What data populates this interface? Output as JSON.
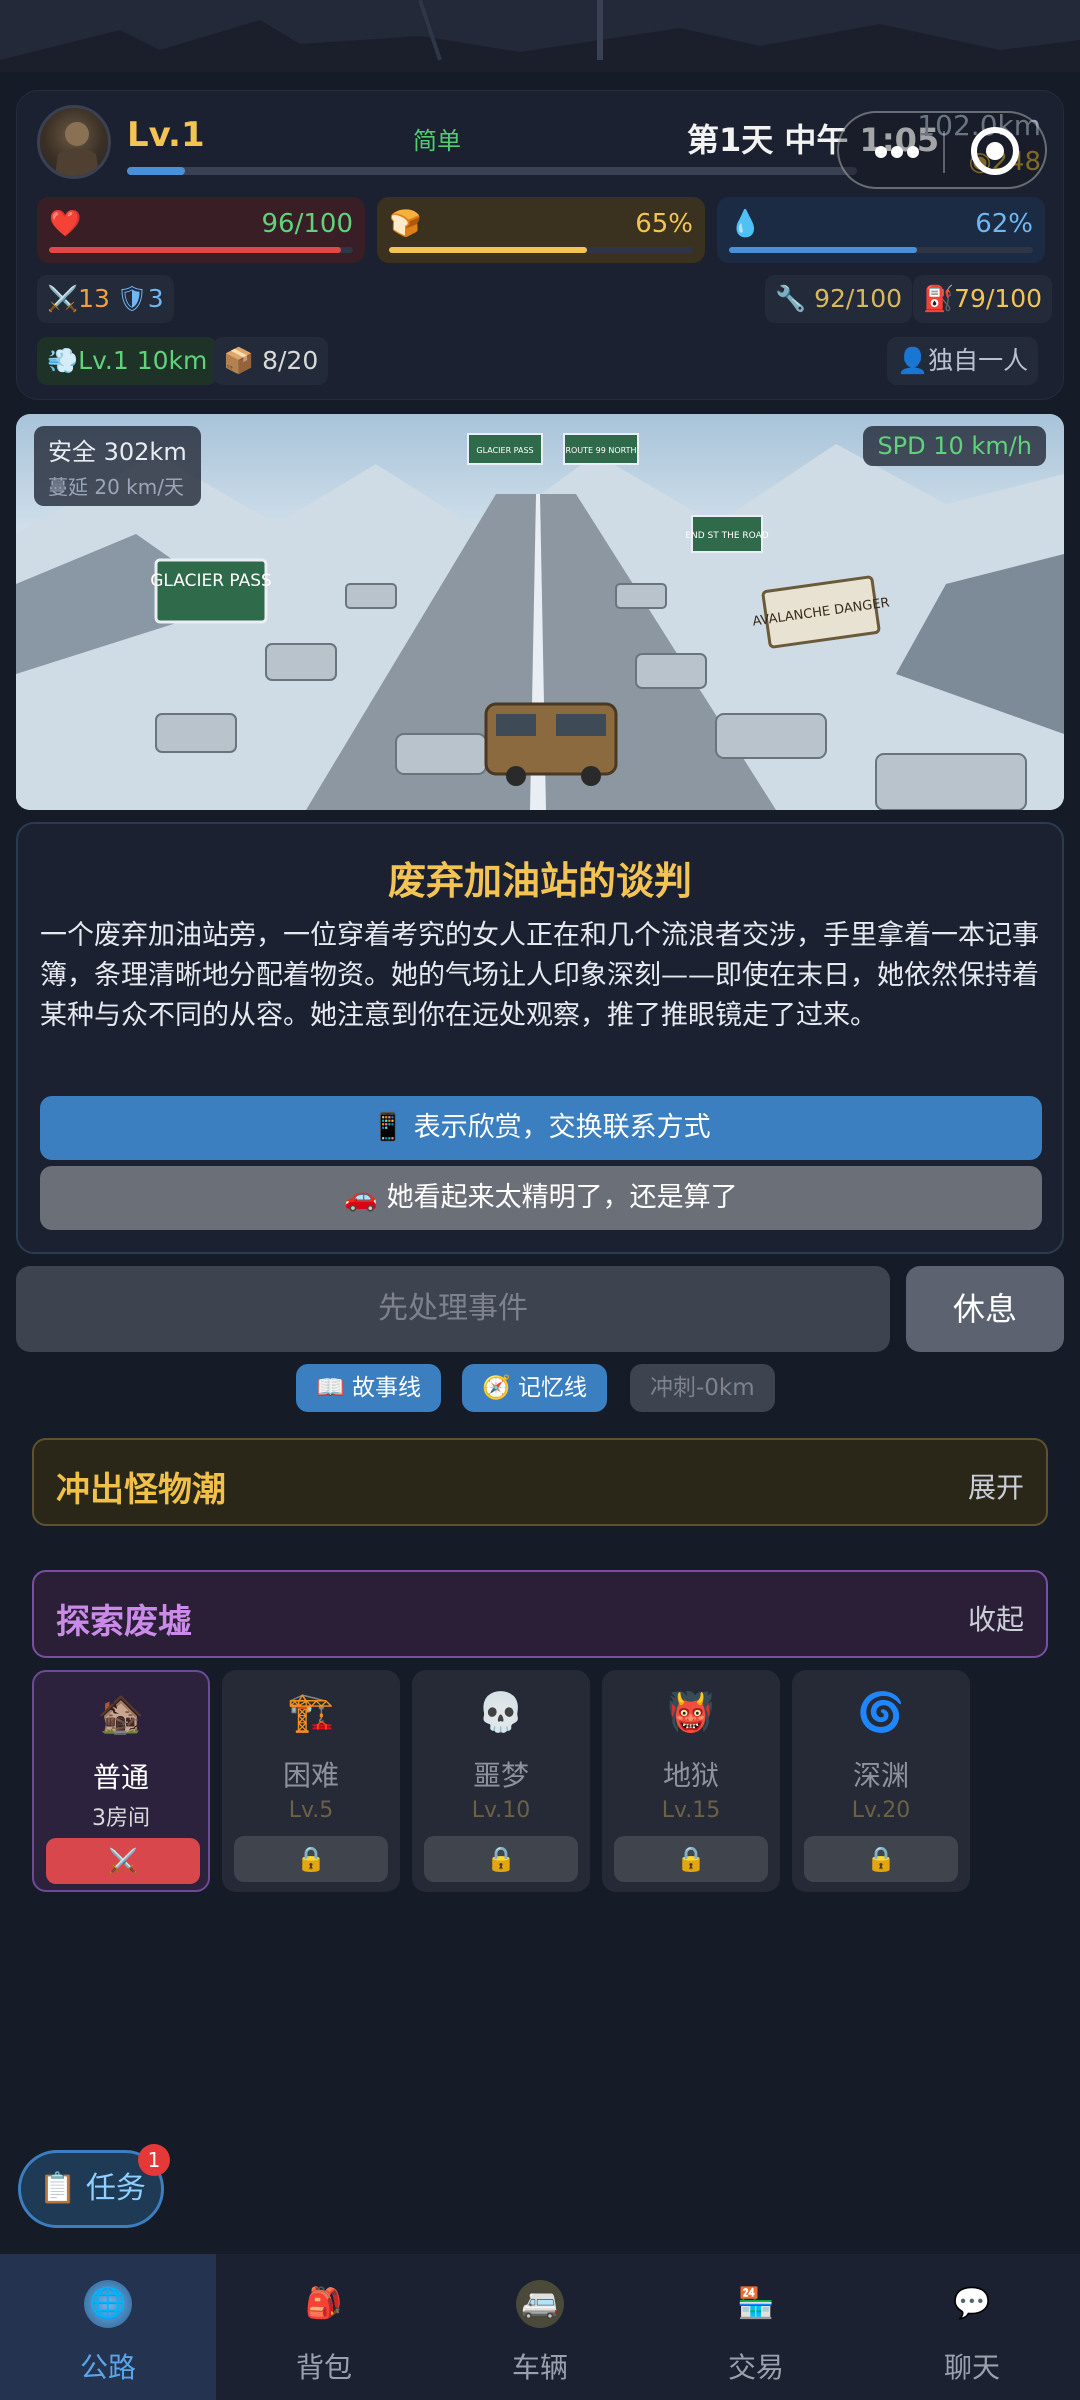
{
  "status": {
    "level": "Lv.1",
    "difficulty": "简单",
    "day_time": "第1天 中午 1:05",
    "distance": "102.0km",
    "coins": "248",
    "xp_fraction": 0.08,
    "hp": {
      "icon": "heart-icon",
      "value": "96/100",
      "fraction": 0.96,
      "color": "#e24646"
    },
    "food": {
      "icon": "bread-icon",
      "value": "65%",
      "fraction": 0.65,
      "color": "#f3c454"
    },
    "water": {
      "icon": "water-drop-icon",
      "value": "62%",
      "fraction": 0.62,
      "color": "#4a90d9"
    },
    "attack": "13",
    "defense": "3",
    "repair": "92/100",
    "fuel": "79/100",
    "speed": "Lv.1 10km",
    "cargo": "8/20",
    "team": "独自一人"
  },
  "scene": {
    "safe_distance": "安全 302km",
    "spread": "蔓延 20 km/天",
    "speed": "SPD 10 km/h",
    "signs": [
      "GLACIER PASS",
      "AVALANCHE DANGER",
      "END ST THE ROAD",
      "GLACIER PASS",
      "ROUTE 99 NORTH"
    ]
  },
  "event": {
    "title": "废弃加油站的谈判",
    "description": "一个废弃加油站旁，一位穿着考究的女人正在和几个流浪者交涉，手里拿着一本记事簿，条理清晰地分配着物资。她的气场让人印象深刻——即使在末日，她依然保持着某种与众不同的从容。她注意到你在远处观察，推了推眼镜走了过来。",
    "choices": [
      {
        "icon": "📱",
        "label": "表示欣赏，交换联系方式"
      },
      {
        "icon": "🚗",
        "label": "她看起来太精明了，还是算了"
      }
    ]
  },
  "actions": {
    "primary": "先处理事件",
    "rest": "休息"
  },
  "pills": {
    "story": "📖 故事线",
    "memory": "🧭 记忆线",
    "sprint": "冲刺-0km"
  },
  "sections": {
    "monster": {
      "title": "冲出怪物潮",
      "action": "展开"
    },
    "ruins": {
      "title": "探索废墟",
      "action": "收起"
    }
  },
  "ruin_levels": [
    {
      "emoji": "🏚️",
      "name": "普通",
      "sub": "3房间",
      "button": "⚔️",
      "icon": "ruin-house-icon",
      "locked": false
    },
    {
      "emoji": "🏗️",
      "name": "困难",
      "sub": "Lv.5",
      "button": "🔒",
      "icon": "crane-icon",
      "locked": true
    },
    {
      "emoji": "💀",
      "name": "噩梦",
      "sub": "Lv.10",
      "button": "🔒",
      "icon": "skull-icon",
      "locked": true
    },
    {
      "emoji": "👹",
      "name": "地狱",
      "sub": "Lv.15",
      "button": "🔒",
      "icon": "demon-icon",
      "locked": true
    },
    {
      "emoji": "🌀",
      "name": "深渊",
      "sub": "Lv.20",
      "button": "🔒",
      "icon": "vortex-icon",
      "locked": true
    }
  ],
  "task": {
    "label": "📋 任务",
    "badge": "1"
  },
  "nav": [
    {
      "label": "公路",
      "icon": "road-globe-icon",
      "active": true
    },
    {
      "label": "背包",
      "icon": "backpack-icon",
      "active": false
    },
    {
      "label": "车辆",
      "icon": "vehicle-icon",
      "active": false
    },
    {
      "label": "交易",
      "icon": "trade-icon",
      "active": false
    },
    {
      "label": "聊天",
      "icon": "chat-icon",
      "active": false
    }
  ]
}
